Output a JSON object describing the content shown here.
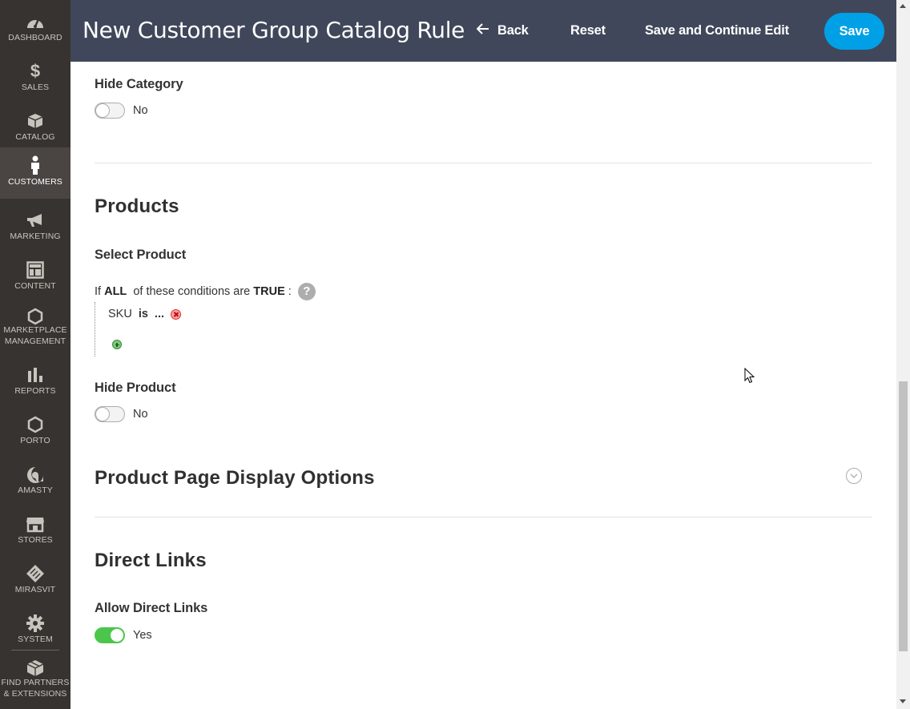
{
  "sidebar": {
    "items": [
      {
        "label": "DASHBOARD",
        "icon": "dashboard-icon"
      },
      {
        "label": "SALES",
        "icon": "dollar-icon"
      },
      {
        "label": "CATALOG",
        "icon": "box-icon"
      },
      {
        "label": "CUSTOMERS",
        "icon": "person-icon",
        "active": true
      },
      {
        "label": "MARKETING",
        "icon": "megaphone-icon"
      },
      {
        "label": "CONTENT",
        "icon": "layout-icon"
      },
      {
        "label": "MARKETPLACE MANAGEMENT",
        "line1": "MARKETPLACE",
        "line2": "MANAGEMENT",
        "icon": "hexagon-icon"
      },
      {
        "label": "REPORTS",
        "icon": "bar-chart-icon"
      },
      {
        "label": "PORTO",
        "icon": "hexagon-icon"
      },
      {
        "label": "AMASTY",
        "icon": "amasty-logo-icon"
      },
      {
        "label": "STORES",
        "icon": "storefront-icon"
      },
      {
        "label": "MIRASVIT",
        "icon": "mirasvit-logo-icon"
      },
      {
        "label": "SYSTEM",
        "icon": "gear-icon"
      },
      {
        "label": "FIND PARTNERS & EXTENSIONS",
        "line1": "FIND PARTNERS",
        "line2": "& EXTENSIONS",
        "icon": "blocks-icon"
      }
    ]
  },
  "header": {
    "title": "New Customer Group Catalog Rule",
    "back_label": "Back",
    "reset_label": "Reset",
    "save_continue_label": "Save and Continue Edit",
    "save_label": "Save"
  },
  "form": {
    "hide_category": {
      "label": "Hide Category",
      "value": "No",
      "enabled": false
    },
    "products_section": {
      "title": "Products"
    },
    "select_product": {
      "label": "Select Product"
    },
    "conditions": {
      "prefix": "If",
      "aggregator": "ALL",
      "middle": "of these conditions are",
      "value": "TRUE",
      "suffix": ":",
      "rule": {
        "attribute": "SKU",
        "operator": "is",
        "value": "..."
      }
    },
    "hide_product": {
      "label": "Hide Product",
      "value": "No",
      "enabled": false
    },
    "product_page_section": {
      "title": "Product Page Display Options"
    },
    "direct_links_section": {
      "title": "Direct Links"
    },
    "allow_direct_links": {
      "label": "Allow Direct Links",
      "value": "Yes",
      "enabled": true
    }
  },
  "colors": {
    "sidebar_bg": "#373330",
    "header_bg": "#41475a",
    "primary_button": "#00a0e6",
    "toggle_on": "#4bc64b"
  }
}
